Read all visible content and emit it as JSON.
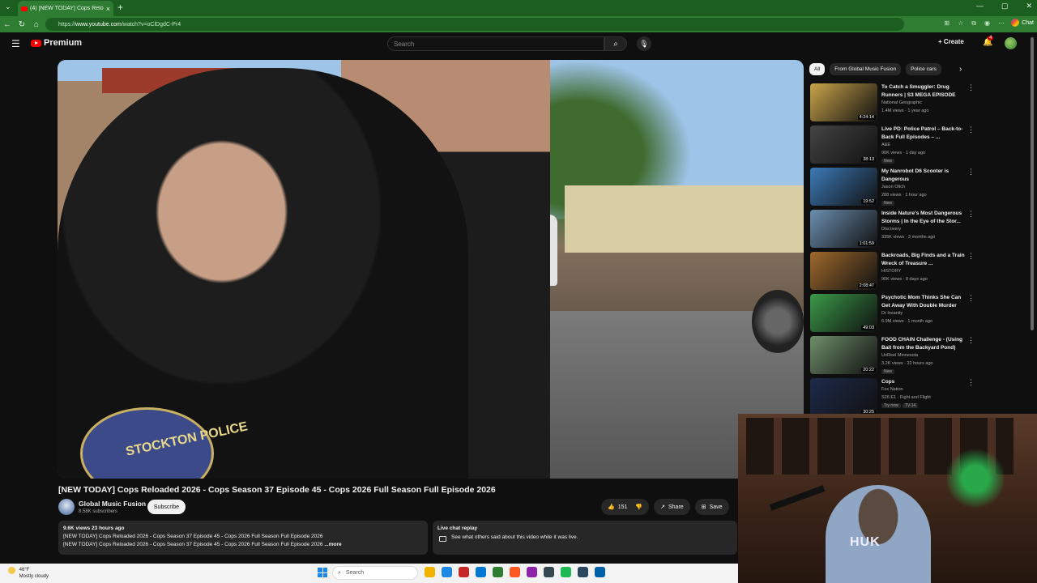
{
  "browser": {
    "tab_title": "(4) [NEW TODAY] Cops Reloa...",
    "new_tab": "+",
    "url_prefix": "https://",
    "url_host": "www.youtube.com",
    "url_path": "/watch?v=oClDgdC-Pr4",
    "chat_label": "Chat"
  },
  "youtube": {
    "logo_text": "Premium",
    "search_placeholder": "Search",
    "create_label": "Create",
    "notif_count": "4"
  },
  "video": {
    "title": "[NEW TODAY] Cops Reloaded 2026 - Cops Season 37 Episode 45 - Cops 2026 Full Season Full Episode 2026",
    "patch_text": "STOCKTON POLICE",
    "channel": "Global Music Fusion",
    "subscribers": "8.58K subscribers",
    "subscribe_label": "Subscribe",
    "likes": "151",
    "share_label": "Share",
    "save_label": "Save",
    "desc_stats": "9.6K views  23 hours ago",
    "desc_line1": "[NEW TODAY] Cops Reloaded 2026 - Cops Season 37 Episode 45 - Cops 2026 Full Season Full Episode 2026",
    "desc_line2": "[NEW TODAY] Cops Reloaded 2026 - Cops Season 37 Episode 45 - Cops 2026 Full Season Full Episode 2026",
    "more_label": "...more",
    "chat_title": "Live chat replay",
    "chat_text": "See what others said about this video while it was live."
  },
  "sidebar": {
    "chips": [
      "All",
      "From Global Music Fusion",
      "Police cars"
    ],
    "items": [
      {
        "title": "To Catch a Smuggler: Drug Runners | S3 MEGA EPISODE",
        "channel": "National Geographic",
        "meta": "1.4M views · 1 year ago",
        "duration": "4:24:14",
        "badge": "",
        "thumb": "#c9a44a"
      },
      {
        "title": "Live PD: Police Patrol – Back-to-Back Full Episodes – ...",
        "channel": "A&E",
        "meta": "90K views · 1 day ago",
        "duration": "38:13",
        "badge": "New",
        "thumb": "#444444"
      },
      {
        "title": "My Nanrobot D6 Scooter is Dangerous",
        "channel": "Jason Oltch",
        "meta": "288 views · 1 hour ago",
        "duration": "19:52",
        "badge": "New",
        "thumb": "#3c7ab8"
      },
      {
        "title": "Inside Nature's Most Dangerous Storms | In the Eye of the Stor...",
        "channel": "Discovery",
        "meta": "335K views · 3 months ago",
        "duration": "1:01:59",
        "badge": "",
        "thumb": "#6b8fb0"
      },
      {
        "title": "Backroads, Big Finds and a Train Wreck of Treasure ...",
        "channel": "HISTORY",
        "meta": "90K views · 8 days ago",
        "duration": "2:08:47",
        "badge": "",
        "thumb": "#a06a2c"
      },
      {
        "title": "Psychotic Mom Thinks She Can Get Away With Double Murder",
        "channel": "Dr Insanity",
        "meta": "6.9M views · 1 month ago",
        "duration": "49:03",
        "badge": "",
        "thumb": "#3a9a48"
      },
      {
        "title": "FOOD CHAIN Challenge - (Using Bait from the Backyard Pond)",
        "channel": "UnReel Minnesota",
        "meta": "3.2K views · 22 hours ago",
        "duration": "20:22",
        "badge": "New",
        "thumb": "#6f8f6a"
      },
      {
        "title": "Cops",
        "channel": "Fox Nation",
        "meta": "S26 E1 · Fight and Flight",
        "duration": "30:25",
        "badge": "Try now",
        "badge2": "TV-14",
        "thumb": "#1d2a4a"
      }
    ]
  },
  "webcam": {
    "shirt_text": "HUK"
  },
  "taskbar": {
    "temp": "46°F",
    "weather": "Mostly cloudy",
    "search_label": "Search",
    "app_colors": [
      "#f0b400",
      "#1e88e5",
      "#c62828",
      "#0078d4",
      "#2e7d32",
      "#ff5722",
      "#8e24aa",
      "#37474f",
      "#1db954",
      "#2a475e",
      "#0061a8"
    ]
  }
}
